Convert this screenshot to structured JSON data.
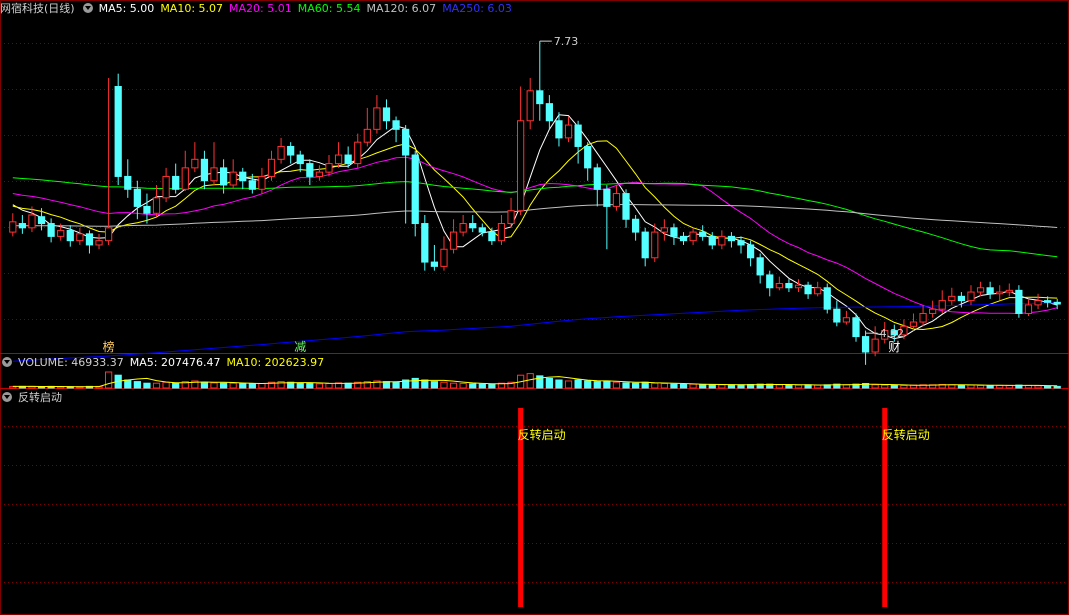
{
  "header": {
    "title": "网宿科技(日线)",
    "ma5": "MA5: 5.00",
    "ma10": "MA10: 5.07",
    "ma20": "MA20: 5.01",
    "ma60": "MA60: 5.54",
    "ma120": "MA120: 6.07",
    "ma250": "MA250: 6.03"
  },
  "volume_header": {
    "volume": "VOLUME: 46933.37",
    "ma5": "MA5: 207476.47",
    "ma10": "MA10: 202623.97"
  },
  "indicator_header": {
    "title": "反转启动"
  },
  "colors": {
    "up": "#ff3232",
    "down": "#54ffff",
    "ma5": "#ffffff",
    "ma10": "#ffff00",
    "ma20": "#ff00ff",
    "ma60": "#00ff00",
    "ma120": "#c0c0c0",
    "ma250": "#0000ff",
    "grid": "#800000",
    "signal": "#ff0000",
    "signal_text": "#ffff00"
  },
  "chart_data": {
    "type": "candlestick",
    "price_range": [
      4.1,
      8.0
    ],
    "high_marker": {
      "value": "7.73",
      "index": 55
    },
    "low_marker": {
      "value": "4.32",
      "index": 89
    },
    "candles": [
      [
        5.5,
        5.62,
        5.72,
        5.45
      ],
      [
        5.6,
        5.55,
        5.7,
        5.48
      ],
      [
        5.55,
        5.7,
        5.8,
        5.5
      ],
      [
        5.68,
        5.6,
        5.78,
        5.52
      ],
      [
        5.6,
        5.45,
        5.66,
        5.38
      ],
      [
        5.45,
        5.52,
        5.6,
        5.4
      ],
      [
        5.52,
        5.4,
        5.58,
        5.33
      ],
      [
        5.4,
        5.48,
        5.55,
        5.35
      ],
      [
        5.48,
        5.35,
        5.52,
        5.25
      ],
      [
        5.35,
        5.4,
        5.48,
        5.3
      ],
      [
        5.4,
        5.55,
        7.3,
        5.35
      ],
      [
        7.2,
        6.15,
        7.35,
        6.05
      ],
      [
        6.15,
        6.0,
        6.35,
        5.9
      ],
      [
        6.0,
        5.8,
        6.1,
        5.65
      ],
      [
        5.8,
        5.72,
        5.95,
        5.6
      ],
      [
        5.72,
        5.9,
        6.05,
        5.68
      ],
      [
        5.9,
        6.15,
        6.25,
        5.85
      ],
      [
        6.15,
        6.0,
        6.3,
        5.95
      ],
      [
        6.0,
        6.25,
        6.45,
        5.98
      ],
      [
        6.25,
        6.35,
        6.55,
        6.2
      ],
      [
        6.35,
        6.1,
        6.45,
        6.0
      ],
      [
        6.1,
        6.25,
        6.55,
        6.05
      ],
      [
        6.25,
        6.05,
        6.35,
        5.95
      ],
      [
        6.05,
        6.2,
        6.35,
        6.0
      ],
      [
        6.2,
        6.1,
        6.25,
        6.0
      ],
      [
        6.1,
        6.0,
        6.18,
        5.95
      ],
      [
        6.0,
        6.15,
        6.25,
        5.95
      ],
      [
        6.15,
        6.35,
        6.45,
        6.1
      ],
      [
        6.35,
        6.5,
        6.6,
        6.3
      ],
      [
        6.5,
        6.4,
        6.55,
        6.3
      ],
      [
        6.4,
        6.3,
        6.45,
        6.2
      ],
      [
        6.3,
        6.15,
        6.35,
        6.05
      ],
      [
        6.15,
        6.2,
        6.28,
        6.1
      ],
      [
        6.2,
        6.3,
        6.4,
        6.15
      ],
      [
        6.3,
        6.4,
        6.55,
        6.25
      ],
      [
        6.4,
        6.3,
        6.5,
        6.25
      ],
      [
        6.3,
        6.55,
        6.65,
        6.25
      ],
      [
        6.55,
        6.7,
        6.95,
        6.5
      ],
      [
        6.7,
        6.95,
        7.1,
        6.65
      ],
      [
        6.95,
        6.8,
        7.05,
        6.7
      ],
      [
        6.8,
        6.7,
        6.85,
        6.55
      ],
      [
        6.7,
        6.4,
        6.75,
        5.6
      ],
      [
        6.4,
        5.6,
        6.45,
        5.45
      ],
      [
        5.6,
        5.15,
        5.7,
        5.05
      ],
      [
        5.15,
        5.1,
        5.35,
        5.05
      ],
      [
        5.1,
        5.3,
        5.45,
        5.05
      ],
      [
        5.3,
        5.5,
        5.65,
        5.25
      ],
      [
        5.5,
        5.6,
        5.7,
        5.45
      ],
      [
        5.6,
        5.55,
        5.7,
        5.5
      ],
      [
        5.55,
        5.5,
        5.6,
        5.45
      ],
      [
        5.5,
        5.4,
        5.55,
        5.35
      ],
      [
        5.4,
        5.6,
        5.7,
        5.35
      ],
      [
        5.6,
        5.75,
        5.9,
        5.55
      ],
      [
        5.75,
        6.8,
        7.2,
        5.7
      ],
      [
        6.8,
        7.15,
        7.3,
        6.7
      ],
      [
        7.15,
        7.0,
        7.73,
        6.8
      ],
      [
        7.0,
        6.8,
        7.1,
        6.7
      ],
      [
        6.8,
        6.6,
        6.9,
        6.5
      ],
      [
        6.6,
        6.75,
        6.85,
        6.55
      ],
      [
        6.75,
        6.5,
        6.8,
        6.3
      ],
      [
        6.5,
        6.25,
        6.55,
        6.1
      ],
      [
        6.25,
        6.0,
        6.3,
        5.8
      ],
      [
        6.0,
        5.8,
        6.05,
        5.3
      ],
      [
        5.8,
        5.95,
        6.05,
        5.75
      ],
      [
        5.95,
        5.65,
        6.0,
        5.55
      ],
      [
        5.65,
        5.5,
        5.7,
        5.4
      ],
      [
        5.5,
        5.2,
        5.55,
        5.1
      ],
      [
        5.2,
        5.5,
        5.6,
        5.15
      ],
      [
        5.5,
        5.55,
        5.65,
        5.4
      ],
      [
        5.55,
        5.45,
        5.6,
        5.35
      ],
      [
        5.45,
        5.4,
        5.5,
        5.35
      ],
      [
        5.4,
        5.5,
        5.55,
        5.35
      ],
      [
        5.5,
        5.45,
        5.58,
        5.4
      ],
      [
        5.45,
        5.35,
        5.5,
        5.3
      ],
      [
        5.35,
        5.45,
        5.52,
        5.3
      ],
      [
        5.45,
        5.4,
        5.5,
        5.32
      ],
      [
        5.4,
        5.35,
        5.45,
        5.25
      ],
      [
        5.35,
        5.2,
        5.4,
        5.1
      ],
      [
        5.2,
        5.0,
        5.25,
        4.9
      ],
      [
        5.0,
        4.85,
        5.05,
        4.75
      ],
      [
        4.85,
        4.9,
        4.98,
        4.82
      ],
      [
        4.9,
        4.85,
        4.95,
        4.8
      ],
      [
        4.85,
        4.88,
        4.95,
        4.8
      ],
      [
        4.88,
        4.78,
        4.92,
        4.72
      ],
      [
        4.78,
        4.85,
        4.92,
        4.75
      ],
      [
        4.85,
        4.6,
        4.9,
        4.55
      ],
      [
        4.6,
        4.45,
        4.7,
        4.4
      ],
      [
        4.45,
        4.5,
        4.58,
        4.42
      ],
      [
        4.5,
        4.28,
        4.55,
        4.22
      ],
      [
        4.28,
        4.1,
        4.35,
        3.95
      ],
      [
        4.1,
        4.25,
        4.4,
        4.05
      ],
      [
        4.25,
        4.35,
        4.45,
        4.2
      ],
      [
        4.35,
        4.3,
        4.42,
        4.22
      ],
      [
        4.3,
        4.4,
        4.48,
        4.25
      ],
      [
        4.4,
        4.45,
        4.55,
        4.35
      ],
      [
        4.45,
        4.55,
        4.65,
        4.4
      ],
      [
        4.55,
        4.6,
        4.7,
        4.5
      ],
      [
        4.6,
        4.7,
        4.82,
        4.55
      ],
      [
        4.7,
        4.75,
        4.85,
        4.65
      ],
      [
        4.75,
        4.7,
        4.8,
        4.62
      ],
      [
        4.7,
        4.8,
        4.88,
        4.65
      ],
      [
        4.8,
        4.85,
        4.92,
        4.75
      ],
      [
        4.85,
        4.78,
        4.92,
        4.72
      ],
      [
        4.78,
        4.8,
        4.88,
        4.7
      ],
      [
        4.8,
        4.82,
        4.9,
        4.75
      ],
      [
        4.82,
        4.55,
        4.88,
        4.5
      ],
      [
        4.55,
        4.65,
        4.72,
        4.52
      ],
      [
        4.65,
        4.7,
        4.78,
        4.6
      ],
      [
        4.7,
        4.68,
        4.75,
        4.62
      ],
      [
        4.68,
        4.66,
        4.72,
        4.6
      ]
    ],
    "volume": [
      0.05,
      0.05,
      0.05,
      0.04,
      0.05,
      0.04,
      0.04,
      0.04,
      0.05,
      0.05,
      0.5,
      0.4,
      0.25,
      0.2,
      0.15,
      0.15,
      0.18,
      0.15,
      0.2,
      0.22,
      0.18,
      0.16,
      0.15,
      0.15,
      0.14,
      0.13,
      0.14,
      0.18,
      0.2,
      0.18,
      0.15,
      0.14,
      0.13,
      0.14,
      0.16,
      0.15,
      0.18,
      0.2,
      0.22,
      0.2,
      0.18,
      0.25,
      0.3,
      0.25,
      0.2,
      0.18,
      0.15,
      0.14,
      0.13,
      0.12,
      0.12,
      0.15,
      0.18,
      0.4,
      0.45,
      0.38,
      0.3,
      0.25,
      0.22,
      0.25,
      0.22,
      0.2,
      0.22,
      0.18,
      0.16,
      0.15,
      0.18,
      0.15,
      0.14,
      0.12,
      0.11,
      0.12,
      0.11,
      0.1,
      0.1,
      0.1,
      0.1,
      0.11,
      0.12,
      0.12,
      0.1,
      0.09,
      0.09,
      0.1,
      0.09,
      0.1,
      0.12,
      0.1,
      0.12,
      0.14,
      0.1,
      0.09,
      0.08,
      0.08,
      0.09,
      0.1,
      0.1,
      0.11,
      0.1,
      0.09,
      0.09,
      0.08,
      0.08,
      0.08,
      0.08,
      0.09,
      0.08,
      0.07,
      0.06,
      0.05
    ],
    "signals": [
      {
        "index": 53,
        "label": "反转启动"
      },
      {
        "index": 91,
        "label": "反转启动"
      }
    ],
    "markers": [
      {
        "index": 10,
        "label": "榜",
        "color": "#ffcc66"
      },
      {
        "index": 30,
        "label": "减",
        "color": "#66ff66"
      },
      {
        "index": 92,
        "label": "财",
        "color": "#ffffff"
      },
      {
        "index": 113,
        "label": "$",
        "color": "#ff3030"
      }
    ]
  }
}
